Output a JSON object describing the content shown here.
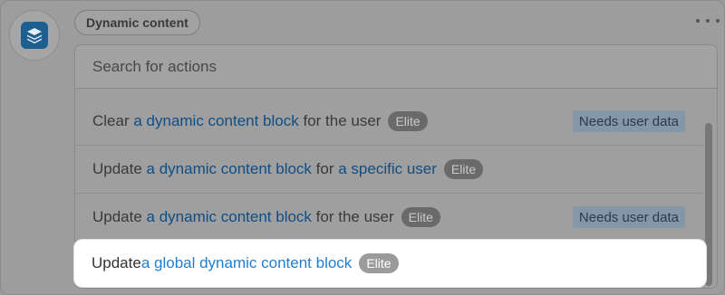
{
  "header": {
    "chip_label": "Dynamic content",
    "app_icon": "layers-icon",
    "more_icon": "more-horizontal-icon"
  },
  "search": {
    "placeholder": "Search for actions"
  },
  "actions": [
    {
      "pre": "Clear ",
      "link": "a dynamic content block",
      "post": " for the user",
      "badge": "Elite",
      "tag": "Needs user data"
    },
    {
      "pre": "Update ",
      "link": "a dynamic content block",
      "mid": " for ",
      "link2": "a specific user",
      "badge": "Elite"
    },
    {
      "pre": "Update ",
      "link": "a dynamic content block",
      "post": " for the user",
      "badge": "Elite",
      "tag": "Needs user data"
    },
    {
      "pre": "Update ",
      "link": "a global dynamic content block",
      "badge": "Elite"
    }
  ],
  "colors": {
    "link": "#1d7fd2",
    "app_icon_bg": "#1d5f8f"
  }
}
